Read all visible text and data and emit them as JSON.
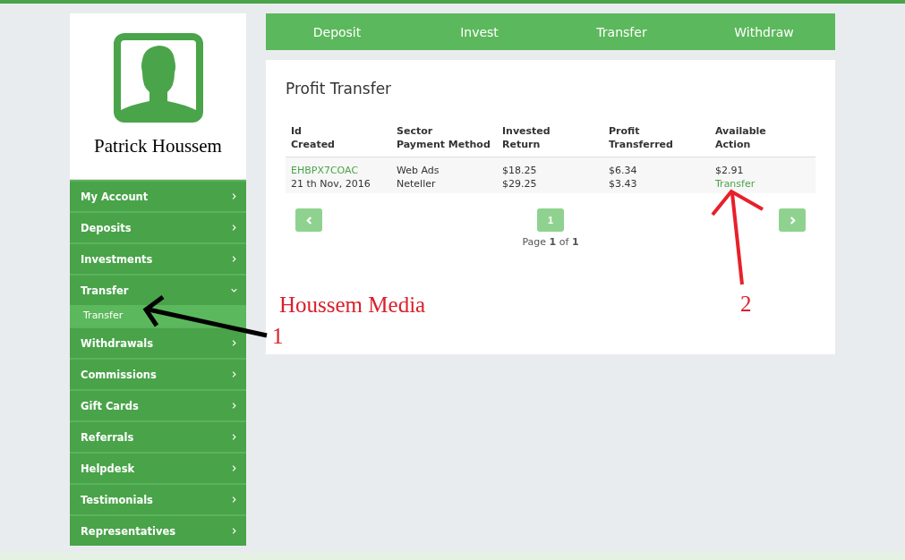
{
  "profile": {
    "name": "Patrick Houssem"
  },
  "menu": [
    {
      "label": "My Account",
      "expanded": false
    },
    {
      "label": "Deposits",
      "expanded": false
    },
    {
      "label": "Investments",
      "expanded": false
    },
    {
      "label": "Transfer",
      "expanded": true,
      "children": [
        {
          "label": "Transfer",
          "selected": true
        }
      ]
    },
    {
      "label": "Withdrawals",
      "expanded": false
    },
    {
      "label": "Commissions",
      "expanded": false
    },
    {
      "label": "Gift Cards",
      "expanded": false
    },
    {
      "label": "Referrals",
      "expanded": false
    },
    {
      "label": "Helpdesk",
      "expanded": false
    },
    {
      "label": "Testimonials",
      "expanded": false
    },
    {
      "label": "Representatives",
      "expanded": false
    }
  ],
  "nav": [
    "Deposit",
    "Invest",
    "Transfer",
    "Withdraw"
  ],
  "panel": {
    "title": "Profit Transfer",
    "header_rows": [
      [
        "Id",
        "Sector",
        "Invested",
        "Profit",
        "Available"
      ],
      [
        "Created",
        "Payment Method",
        "Return",
        "Transferred",
        "Action"
      ]
    ],
    "rows": [
      {
        "cells": [
          {
            "text": "EHBPX7COAC",
            "kind": "link"
          },
          {
            "text": "Web Ads",
            "kind": "text"
          },
          {
            "text": "$18.25",
            "kind": "text"
          },
          {
            "text": "$6.34",
            "kind": "text"
          },
          {
            "text": "$2.91",
            "kind": "text"
          }
        ]
      },
      {
        "cells": [
          {
            "text": "21 th Nov, 2016",
            "kind": "text"
          },
          {
            "text": "Neteller",
            "kind": "text"
          },
          {
            "text": "$29.25",
            "kind": "text"
          },
          {
            "text": "$3.43",
            "kind": "text"
          },
          {
            "text": "Transfer",
            "kind": "link"
          }
        ]
      }
    ],
    "pagination": {
      "page": "1",
      "info": "Page **1** of **1**"
    }
  },
  "annotations": [
    {
      "text": "Houssem Media"
    },
    {
      "text": "1"
    },
    {
      "text": "2"
    }
  ]
}
